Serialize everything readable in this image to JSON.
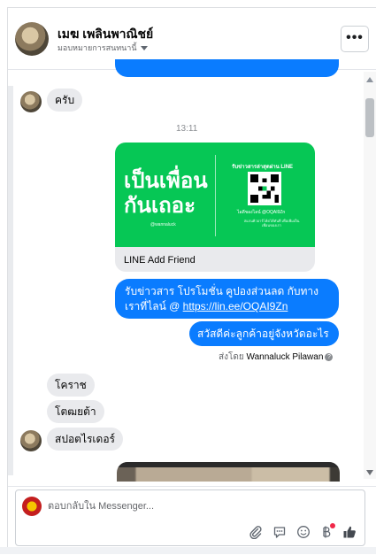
{
  "header": {
    "name": "เมฆ เพลินพาณิชย์",
    "assign_label": "มอบหมายการสนทนานี้",
    "more_label": "•••"
  },
  "thread": {
    "reply_in_1": "ครับ",
    "timestamp": "13:11",
    "card": {
      "big_text_line1": "เป็นเพื่อน",
      "big_text_line2": "กันเถอะ",
      "tagline": "@wannaluck",
      "scan_text": "รับข่าวสารล่าสุดผ่าน LINE",
      "id_text": "ไอดีของไลน์ @OQAI9Zn",
      "fine_print": "สแกนคิวอาร์โค้ดได้ทันที เพื่อเพิ่มเป็นเพื่อนของเรา",
      "title": "LINE Add Friend"
    },
    "out_msg_1_prefix": "รับข่าวสาร  โปรโมชั่น คูปองส่วนลด กับทางเราที่ไลน์ @ ",
    "out_msg_1_link": "https://lin.ee/OQAI9Zn",
    "out_msg_2": "สวัสดีค่ะลูกค้าอยู่จังหวัดอะไรคะ",
    "sent_by_prefix": "ส่งโดย",
    "sent_by_name": "Wannaluck Pilawan",
    "info_glyph": "?",
    "in_msg_2": "โคราช",
    "in_msg_3": "โตฒยต้า",
    "in_msg_4": "สปอตไรเดอร์"
  },
  "composer": {
    "placeholder": "ตอบกลับใน Messenger..."
  },
  "icons": [
    "paperclip-icon",
    "saved-reply-icon",
    "emoji-icon",
    "baht-icon",
    "like-icon"
  ],
  "colors": {
    "outgoing_bubble": "#0a7cff",
    "incoming_bubble": "#e9eaed",
    "line_green": "#06c755",
    "notification_dot": "#f02849"
  }
}
